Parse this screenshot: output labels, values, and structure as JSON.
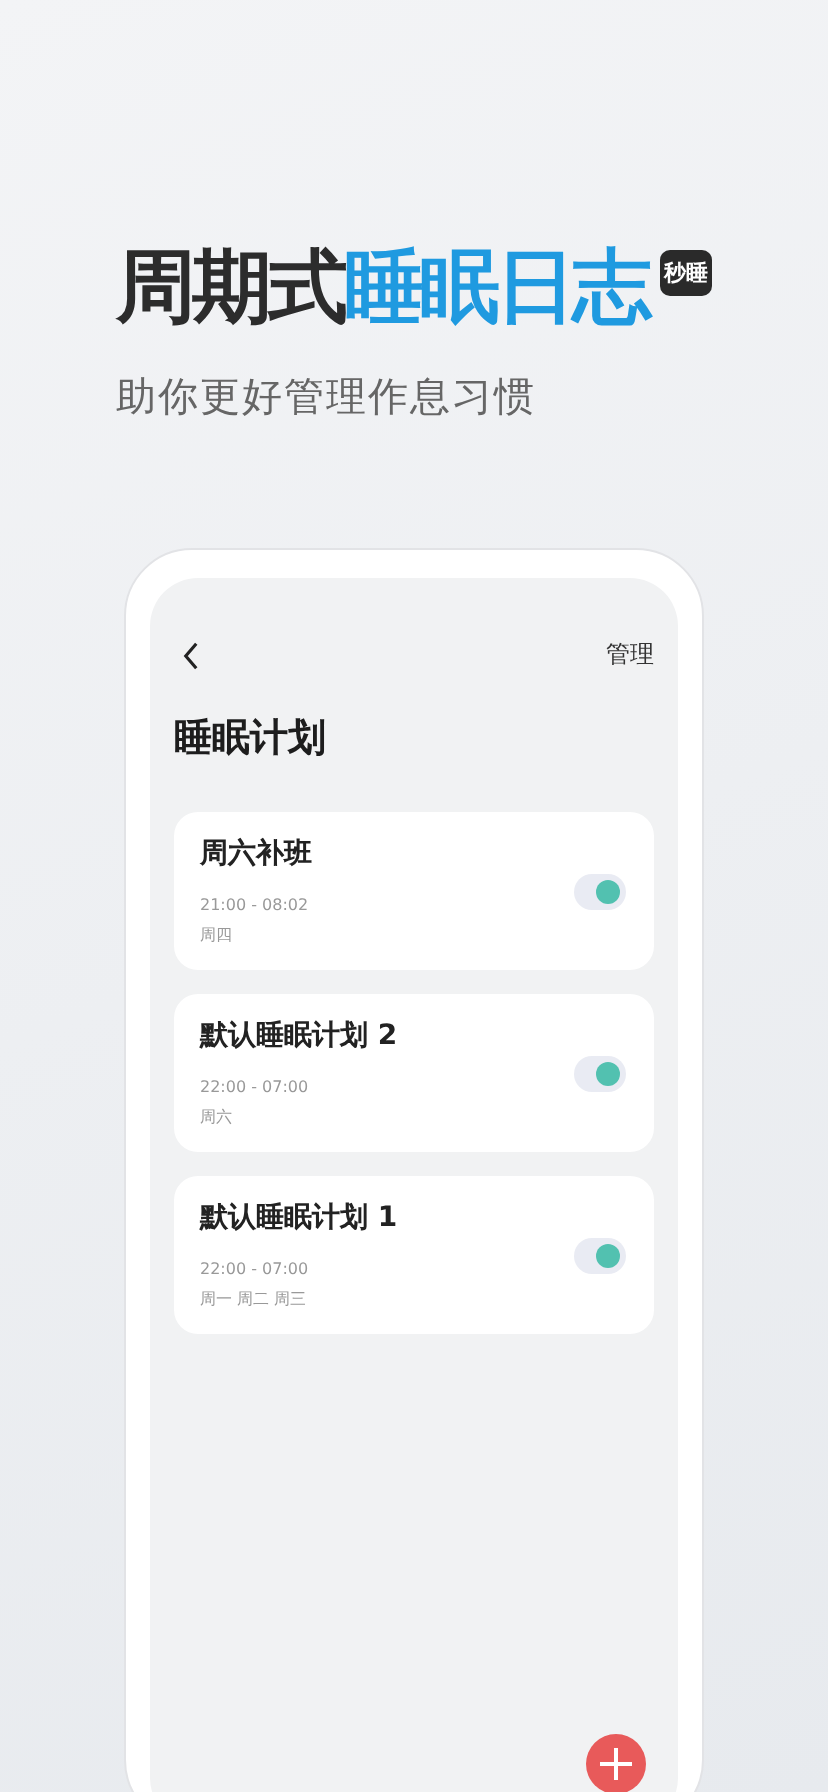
{
  "headline": {
    "dark": "周期式",
    "accent": "睡眠日志",
    "logo": "秒睡"
  },
  "subtitle": "助你更好管理作息习惯",
  "screen": {
    "manage": "管理",
    "title": "睡眠计划",
    "plans": [
      {
        "name": "周六补班",
        "time": "21:00 - 08:02",
        "days": "周四",
        "on": true
      },
      {
        "name": "默认睡眠计划 2",
        "time": "22:00 - 07:00",
        "days": "周六",
        "on": true
      },
      {
        "name": "默认睡眠计划 1",
        "time": "22:00 - 07:00",
        "days": "周一 周二 周三",
        "on": true
      }
    ]
  }
}
